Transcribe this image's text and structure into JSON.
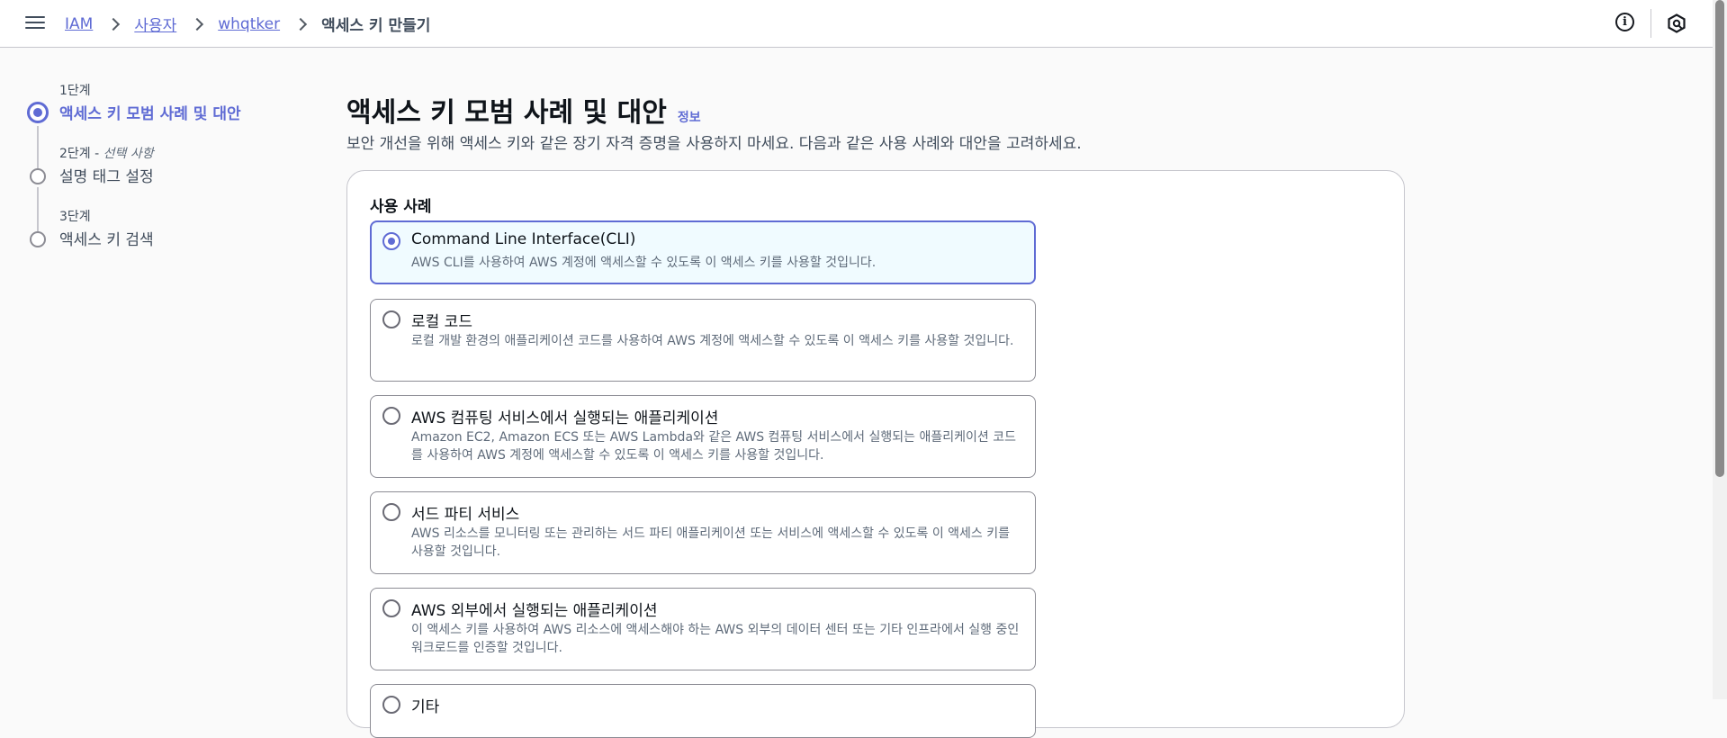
{
  "breadcrumb": {
    "items": [
      "IAM",
      "사용자",
      "whqtker"
    ],
    "current": "액세스 키 만들기"
  },
  "header": {
    "info_icon": "info-icon",
    "profile_icon": "hexagon-icon"
  },
  "steps": [
    {
      "meta": "1단계",
      "optional": "",
      "title": "액세스 키 모범 사례 및 대안",
      "active": true
    },
    {
      "meta": "2단계 - ",
      "optional": "선택 사항",
      "title": "설명 태그 설정",
      "active": false
    },
    {
      "meta": "3단계",
      "optional": "",
      "title": "액세스 키 검색",
      "active": false
    }
  ],
  "main": {
    "title": "액세스 키 모범 사례 및 대안",
    "info_link": "정보",
    "description": "보안 개선을 위해 액세스 키와 같은 장기 자격 증명을 사용하지 마세요. 다음과 같은 사용 사례와 대안을 고려하세요.",
    "section_label": "사용 사례",
    "options": [
      {
        "title": "Command Line Interface(CLI)",
        "desc": "AWS CLI를 사용하여 AWS 계정에 액세스할 수 있도록 이 액세스 키를 사용할 것입니다.",
        "selected": true
      },
      {
        "title": "로컬 코드",
        "desc": "로컬 개발 환경의 애플리케이션 코드를 사용하여 AWS 계정에 액세스할 수 있도록 이 액세스 키를 사용할 것입니다.",
        "selected": false
      },
      {
        "title": "AWS 컴퓨팅 서비스에서 실행되는 애플리케이션",
        "desc": "Amazon EC2, Amazon ECS 또는 AWS Lambda와 같은 AWS 컴퓨팅 서비스에서 실행되는 애플리케이션 코드를 사용하여 AWS 계정에 액세스할 수 있도록 이 액세스 키를 사용할 것입니다.",
        "selected": false
      },
      {
        "title": "서드 파티 서비스",
        "desc": "AWS 리소스를 모니터링 또는 관리하는 서드 파티 애플리케이션 또는 서비스에 액세스할 수 있도록 이 액세스 키를 사용할 것입니다.",
        "selected": false
      },
      {
        "title": "AWS 외부에서 실행되는 애플리케이션",
        "desc": "이 액세스 키를 사용하여 AWS 리소스에 액세스해야 하는 AWS 외부의 데이터 센터 또는 기타 인프라에서 실행 중인 워크로드를 인증할 것입니다.",
        "selected": false
      },
      {
        "title": "기타",
        "desc": "",
        "selected": false
      }
    ]
  },
  "colors": {
    "accent": "#5f6bd4",
    "selected_bg": "#f0fbff",
    "border": "#8c8c94"
  }
}
